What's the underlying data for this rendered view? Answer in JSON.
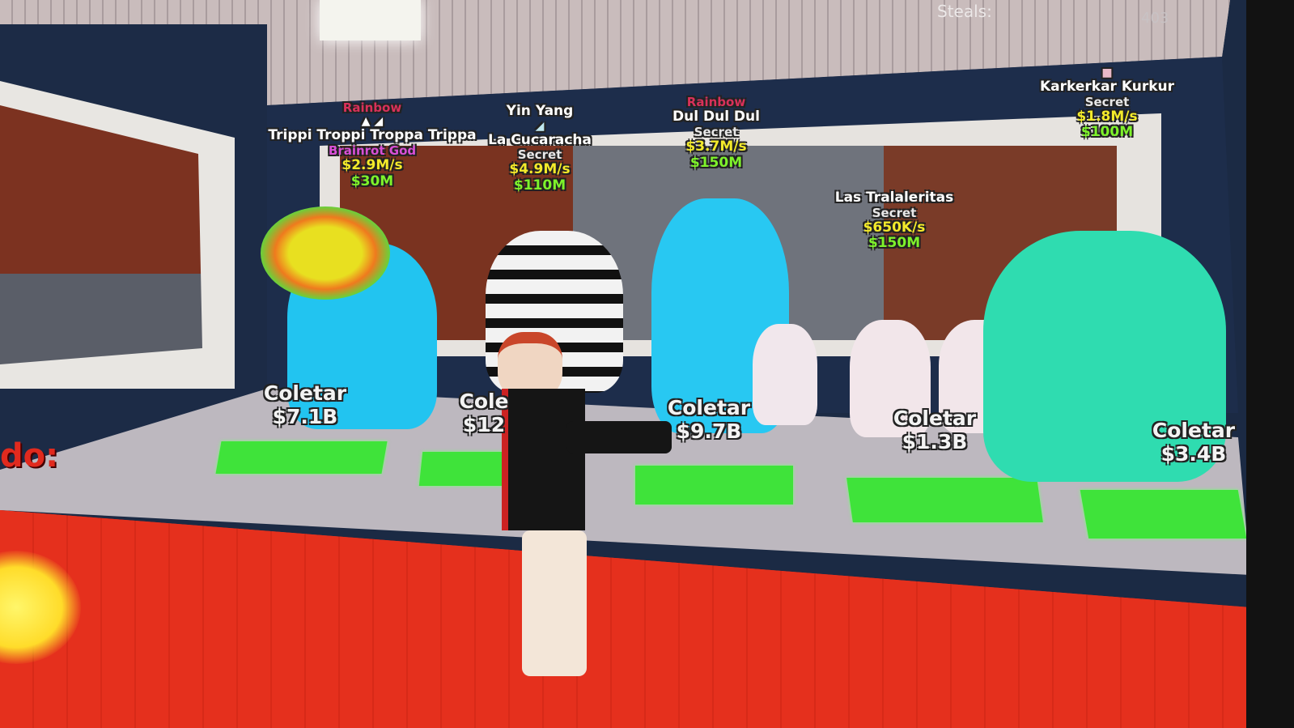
{
  "hud": {
    "steals_label": "Steals:",
    "steals_value": "403",
    "side_text": "do:"
  },
  "brainrots": [
    {
      "mutation": "Rainbow",
      "name": "Trippi Troppi Troppa Trippa",
      "rarity": "Brainrot God",
      "rate": "$2.9M/s",
      "price": "$30M"
    },
    {
      "mutation": "Yin Yang",
      "name": "La Cucaracha",
      "rarity": "Secret",
      "rate": "$4.9M/s",
      "price": "$110M"
    },
    {
      "mutation": "Rainbow",
      "name": "Dul Dul Dul",
      "rarity": "Secret",
      "rate": "$3.7M/s",
      "price": "$150M"
    },
    {
      "name": "Las Tralaleritas",
      "rarity": "Secret",
      "rate": "$650K/s",
      "price": "$150M"
    },
    {
      "name": "Karkerkar Kurkur",
      "rarity": "Secret",
      "rate": "$1.8M/s",
      "price": "$100M"
    }
  ],
  "collect": [
    {
      "label": "Coletar",
      "amount": "$7.1B"
    },
    {
      "label": "Cole",
      "amount": "$12"
    },
    {
      "label": "Coletar",
      "amount": "$9.7B"
    },
    {
      "label": "Coletar",
      "amount": "$1.3B"
    },
    {
      "label": "Coletar",
      "amount": "$3.4B"
    }
  ],
  "colors": {
    "pad": "#3fe33a",
    "carpet": "#e3301c",
    "rate": "#f3ea2a",
    "price": "#7ef22b"
  }
}
